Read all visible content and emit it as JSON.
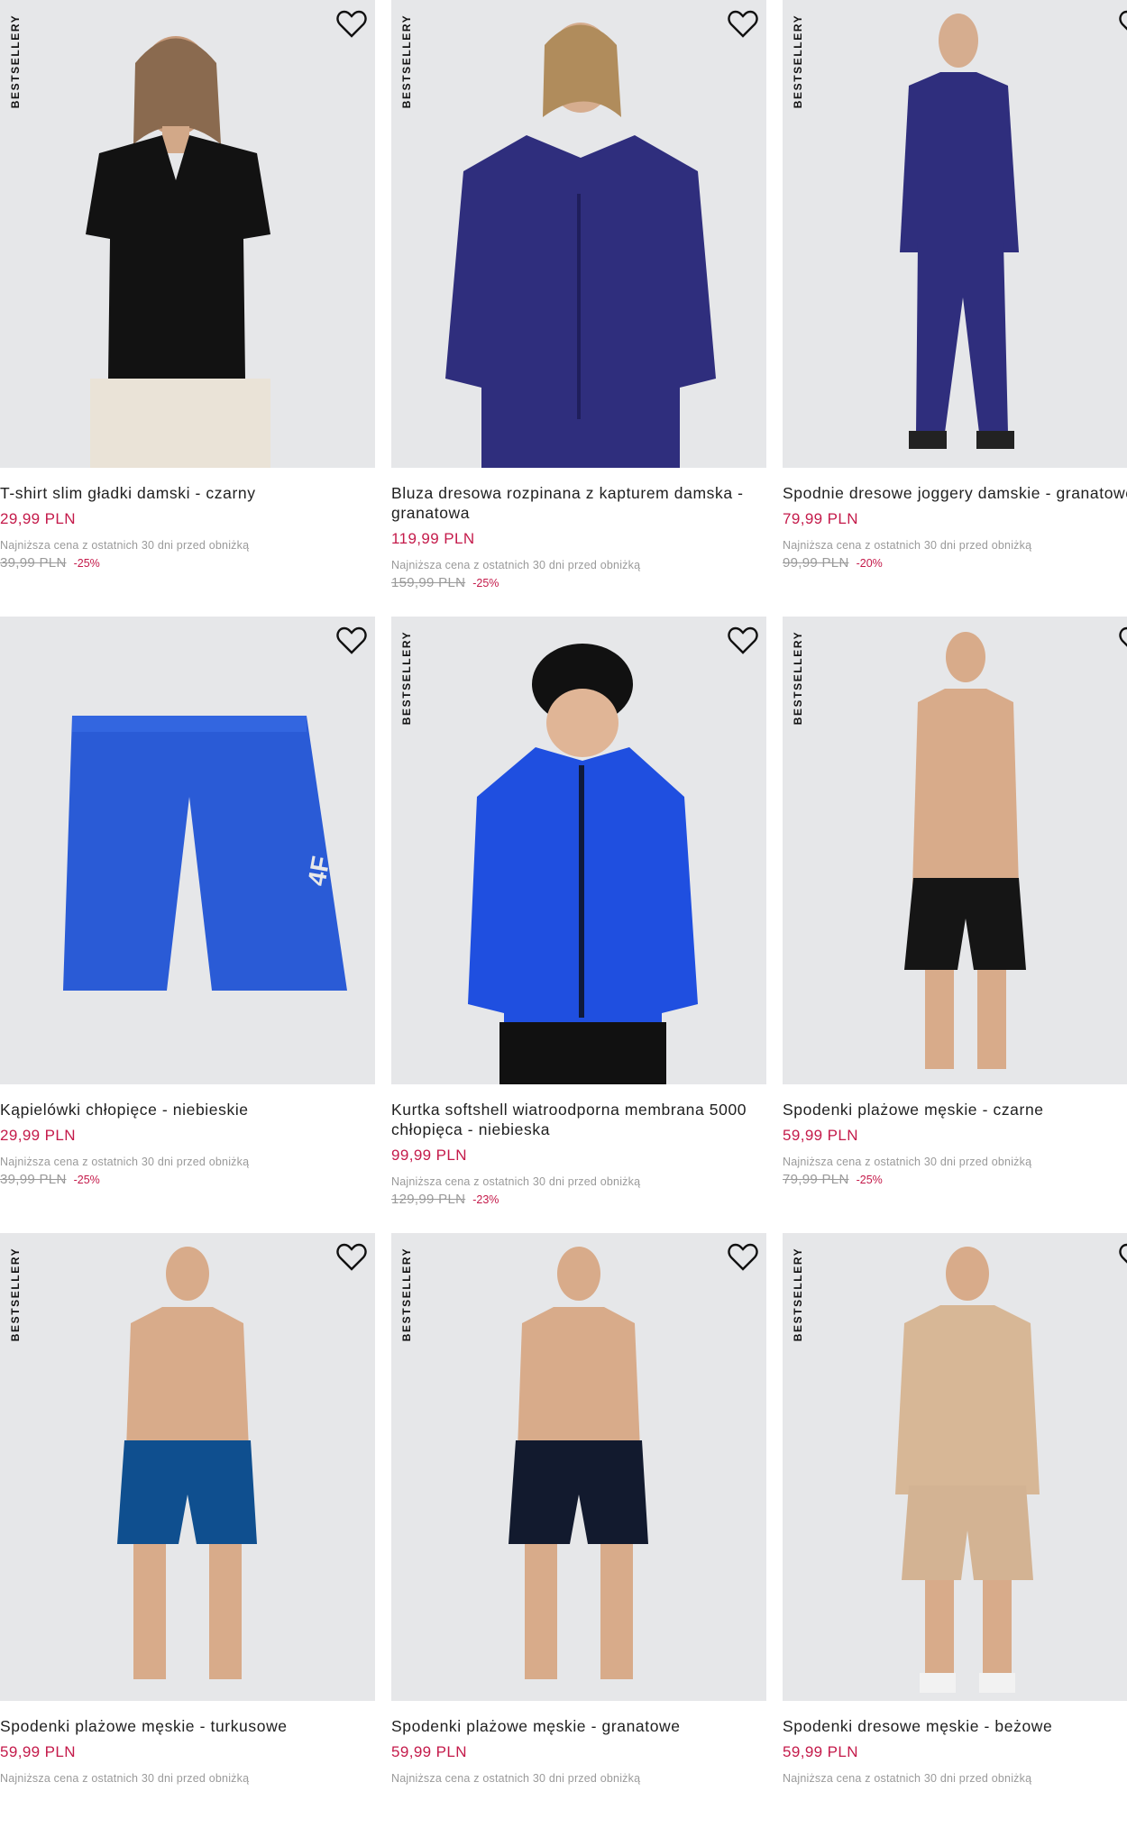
{
  "badge_text": "BESTSELLERY",
  "lowest_label": "Najniższa cena z ostatnich 30 dni przed obniżką",
  "colors": {
    "price": "#c41a4a",
    "photo_bg": "#e6e7e9",
    "muted": "#9a9a9a"
  },
  "products": [
    {
      "name": "T-shirt slim gładki damski - czarny",
      "price": "29,99 PLN",
      "old_price": "39,99 PLN",
      "discount": "-25%",
      "badge": true
    },
    {
      "name": "Bluza dresowa rozpinana z kapturem damska - granatowa",
      "price": "119,99 PLN",
      "old_price": "159,99 PLN",
      "discount": "-25%",
      "badge": true
    },
    {
      "name": "Spodnie dresowe joggery damskie - granatowe",
      "price": "79,99 PLN",
      "old_price": "99,99 PLN",
      "discount": "-20%",
      "badge": true
    },
    {
      "name": "Kąpielówki chłopięce - niebieskie",
      "price": "29,99 PLN",
      "old_price": "39,99 PLN",
      "discount": "-25%",
      "badge": false
    },
    {
      "name": "Kurtka softshell wiatroodporna membrana 5000 chłopięca - niebieska",
      "price": "99,99 PLN",
      "old_price": "129,99 PLN",
      "discount": "-23%",
      "badge": true
    },
    {
      "name": "Spodenki plażowe męskie - czarne",
      "price": "59,99 PLN",
      "old_price": "79,99 PLN",
      "discount": "-25%",
      "badge": true
    },
    {
      "name": "Spodenki plażowe męskie - turkusowe",
      "price": "59,99 PLN",
      "badge": true
    },
    {
      "name": "Spodenki plażowe męskie - granatowe",
      "price": "59,99 PLN",
      "badge": true
    },
    {
      "name": "Spodenki dresowe męskie - beżowe",
      "price": "59,99 PLN",
      "badge": true
    }
  ]
}
